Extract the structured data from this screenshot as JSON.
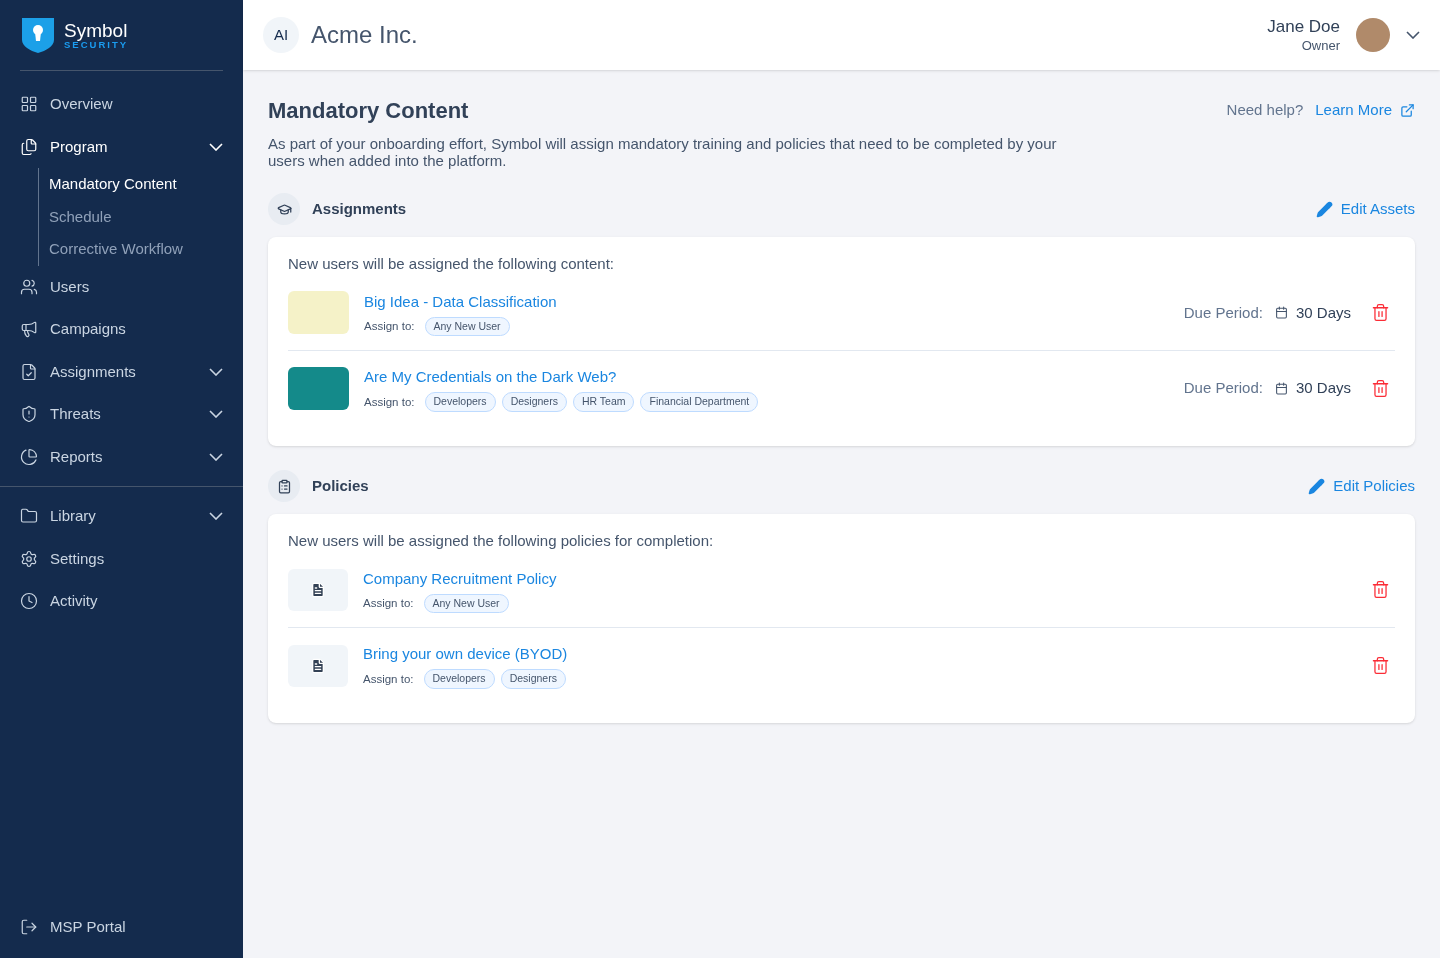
{
  "brand": {
    "name": "Symbol",
    "tagline": "SECURITY"
  },
  "sidebar": {
    "sections": [
      {
        "items": [
          {
            "label": "Overview",
            "selected": false,
            "expandable": false
          },
          {
            "label": "Program",
            "selected": true,
            "expandable": true,
            "children": [
              {
                "label": "Mandatory Content",
                "selected": true
              },
              {
                "label": "Schedule",
                "selected": false
              },
              {
                "label": "Corrective Workflow",
                "selected": false
              }
            ]
          },
          {
            "label": "Users",
            "selected": false,
            "expandable": false
          },
          {
            "label": "Campaigns",
            "selected": false,
            "expandable": false
          },
          {
            "label": "Assignments",
            "selected": false,
            "expandable": true
          },
          {
            "label": "Threats",
            "selected": false,
            "expandable": true
          },
          {
            "label": "Reports",
            "selected": false,
            "expandable": true
          }
        ]
      },
      {
        "items": [
          {
            "label": "Library",
            "selected": false,
            "expandable": true
          },
          {
            "label": "Settings",
            "selected": false,
            "expandable": false
          },
          {
            "label": "Activity",
            "selected": false,
            "expandable": false
          }
        ]
      }
    ],
    "footer": {
      "label": "MSP Portal"
    }
  },
  "header": {
    "org_initials": "AI",
    "org_name": "Acme Inc.",
    "user_name": "Jane Doe",
    "user_role": "Owner"
  },
  "page": {
    "title": "Mandatory Content",
    "help_text": "Need help?",
    "help_link": "Learn More",
    "description": "As part of your onboarding effort, Symbol will assign mandatory training and policies that need to be completed by your users when added into the platform."
  },
  "sections": [
    {
      "kind": "assignments",
      "title": "Assignments",
      "edit_label": "Edit Assets",
      "intro": "New users will be assigned the following content:",
      "items": [
        {
          "title": "Big Idea - Data Classification",
          "assign_label": "Assign to:",
          "tags": [
            "Any New User"
          ],
          "due_label": "Due Period:",
          "due_value": "30 Days"
        },
        {
          "title": "Are My Credentials on the Dark Web?",
          "assign_label": "Assign to:",
          "tags": [
            "Developers",
            "Designers",
            "HR Team",
            "Financial Department"
          ],
          "due_label": "Due Period:",
          "due_value": "30 Days"
        }
      ]
    },
    {
      "kind": "policies",
      "title": "Policies",
      "edit_label": "Edit Policies",
      "intro": "New users will be assigned the following policies for completion:",
      "items": [
        {
          "title": "Company Recruitment Policy",
          "assign_label": "Assign to:",
          "tags": [
            "Any New User"
          ]
        },
        {
          "title": "Bring your own device (BYOD)",
          "assign_label": "Assign to:",
          "tags": [
            "Developers",
            "Designers"
          ]
        }
      ]
    }
  ]
}
